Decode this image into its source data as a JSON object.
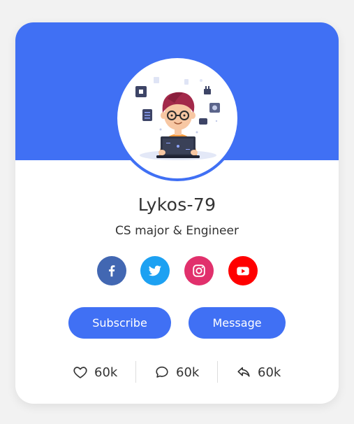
{
  "profile": {
    "name": "Lykos-79",
    "role": "CS major & Engineer",
    "avatar_icon": "developer-avatar-illustration"
  },
  "socials": [
    {
      "name": "facebook",
      "icon": "facebook-icon",
      "color": "#4267b2"
    },
    {
      "name": "twitter",
      "icon": "twitter-icon",
      "color": "#1da1f2"
    },
    {
      "name": "instagram",
      "icon": "instagram-icon",
      "color": "#e1306c"
    },
    {
      "name": "youtube",
      "icon": "youtube-icon",
      "color": "#ff0000"
    }
  ],
  "buttons": {
    "subscribe_label": "Subscribe",
    "message_label": "Message"
  },
  "stats": {
    "likes": "60k",
    "comments": "60k",
    "shares": "60k"
  },
  "colors": {
    "accent": "#4070f4",
    "background": "#f2f2f2",
    "card": "#ffffff",
    "text": "#333333"
  }
}
